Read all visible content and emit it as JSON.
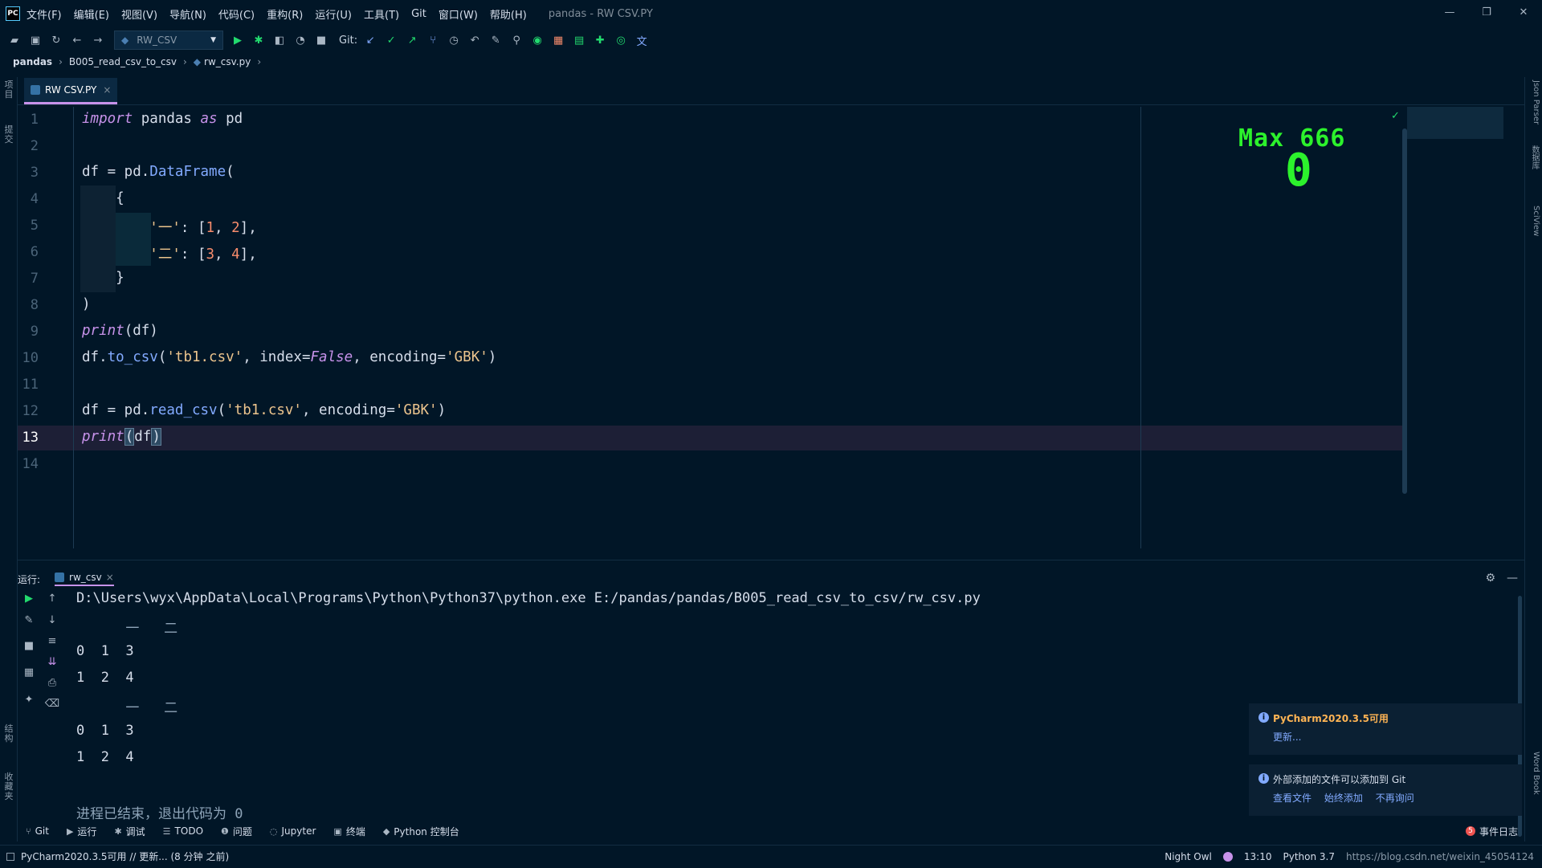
{
  "menu": {
    "items": [
      "文件(F)",
      "编辑(E)",
      "视图(V)",
      "导航(N)",
      "代码(C)",
      "重构(R)",
      "运行(U)",
      "工具(T)",
      "Git",
      "窗口(W)",
      "帮助(H)"
    ],
    "window_title": "pandas - RW CSV.PY"
  },
  "window_controls": {
    "minimize": "—",
    "restore": "❐",
    "close": "✕"
  },
  "toolbar": {
    "run_config": "RW_CSV",
    "git_label": "Git:"
  },
  "breadcrumb": {
    "project": "pandas",
    "folder": "B005_read_csv_to_csv",
    "file": "rw_csv.py"
  },
  "left_strip": {
    "project": "项目",
    "commit": "提交",
    "structure": "结构",
    "favorites": "收藏夹"
  },
  "right_strip": {
    "json": "Json Parser",
    "db": "数据库",
    "sciview": "SciView",
    "wordbook": "Word Book"
  },
  "editor": {
    "tab_label": "RW CSV.PY",
    "current_line": "13",
    "line_numbers": [
      "1",
      "2",
      "3",
      "4",
      "5",
      "6",
      "7",
      "8",
      "9",
      "10",
      "11",
      "12",
      "13",
      "14"
    ],
    "lines": {
      "l1": {
        "kw": "import",
        "t1": " pandas ",
        "kw2": "as",
        "t2": " pd"
      },
      "l3": {
        "t1": "df = pd.",
        "fn": "DataFrame",
        "t2": "("
      },
      "l4": {
        "t": "    {"
      },
      "l5": {
        "pad": "        ",
        "s": "'一'",
        "t1": ": [",
        "n1": "1",
        "t2": ", ",
        "n2": "2",
        "t3": "],"
      },
      "l6": {
        "pad": "        ",
        "s": "'二'",
        "t1": ": [",
        "n1": "3",
        "t2": ", ",
        "n2": "4",
        "t3": "],"
      },
      "l7": {
        "t": "    }"
      },
      "l8": {
        "t": ")"
      },
      "l9": {
        "fn": "print",
        "t": "(df)"
      },
      "l10": {
        "t1": "df.",
        "fn": "to_csv",
        "t2": "(",
        "s1": "'tb1.csv'",
        "t3": ", index=",
        "kv": "False",
        "t4": ", encoding=",
        "s2": "'GBK'",
        "t5": ")"
      },
      "l12": {
        "t1": "df = pd.",
        "fn": "read_csv",
        "t2": "(",
        "s1": "'tb1.csv'",
        "t3": ", encoding=",
        "s2": "'GBK'",
        "t4": ")"
      },
      "l13": {
        "fn": "print",
        "b1": "(",
        "t": "df",
        "b2": ")"
      }
    }
  },
  "overlay": {
    "score_text": "Max 666",
    "score_value": "0"
  },
  "run_panel": {
    "label": "运行:",
    "tab": "rw_csv",
    "output": [
      {
        "text": "D:\\Users\\wyx\\AppData\\Local\\Programs\\Python\\Python37\\python.exe E:/pandas/pandas/B005_read_csv_to_csv/rw_csv.py",
        "dim": false
      },
      {
        "text": "      一   二",
        "dim": true
      },
      {
        "text": "0  1  3",
        "dim": false
      },
      {
        "text": "1  2  4",
        "dim": false
      },
      {
        "text": "      一   二",
        "dim": true
      },
      {
        "text": "0  1  3",
        "dim": false
      },
      {
        "text": "1  2  4",
        "dim": false
      },
      {
        "text": "",
        "dim": false
      },
      {
        "text": "进程已结束，退出代码为 0",
        "dim": true
      }
    ]
  },
  "notifications": [
    {
      "title": "PyCharm2020.3.5可用",
      "links": [
        "更新..."
      ],
      "highlight": true
    },
    {
      "title": "外部添加的文件可以添加到 Git",
      "links": [
        "查看文件",
        "始终添加",
        "不再询问"
      ],
      "highlight": false
    }
  ],
  "bottom_tabs": [
    "Git",
    "运行",
    "调试",
    "TODO",
    "问题",
    "Jupyter",
    "终端",
    "Python 控制台"
  ],
  "event_log": {
    "badge": "5",
    "label": "事件日志"
  },
  "status": {
    "left": "PyCharm2020.3.5可用 // 更新... (8 分钟 之前)",
    "theme": "Night Owl",
    "position": "13:10",
    "interpreter": "Python 3.7",
    "watermark": "https://blog.csdn.net/weixin_45054124"
  },
  "colors": {
    "background": "#011627",
    "keyword": "#c792ea",
    "function": "#82aaff",
    "string": "#ecc48d",
    "number": "#f78c6c",
    "score": "#2cf22c"
  }
}
